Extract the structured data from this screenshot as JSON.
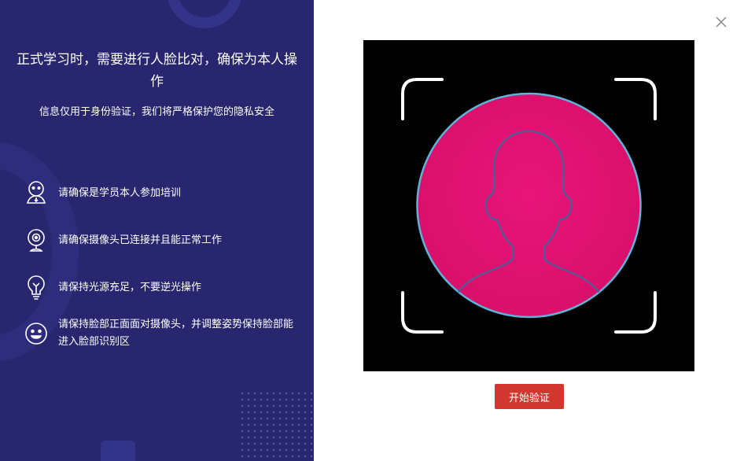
{
  "left": {
    "title": "正式学习时，需要进行人脸比对，确保为本人操作",
    "subtitle": "信息仅用于身份验证，我们将严格保护您的隐私安全",
    "tips": [
      {
        "icon": "person-badge-icon",
        "text": "请确保是学员本人参加培训"
      },
      {
        "icon": "webcam-icon",
        "text": "请确保摄像头已连接并且能正常工作"
      },
      {
        "icon": "light-bulb-icon",
        "text": "请保持光源充足，不要逆光操作"
      },
      {
        "icon": "smiley-face-icon",
        "text": "请保持脸部正面面对摄像头，并调整姿势保持脸部能进入脸部识别区"
      }
    ]
  },
  "right": {
    "close_icon": "close-icon",
    "start_button": "开始验证"
  },
  "colors": {
    "left_background": "#27266f",
    "face_circle": "#e0156f",
    "button": "#d1372f"
  }
}
